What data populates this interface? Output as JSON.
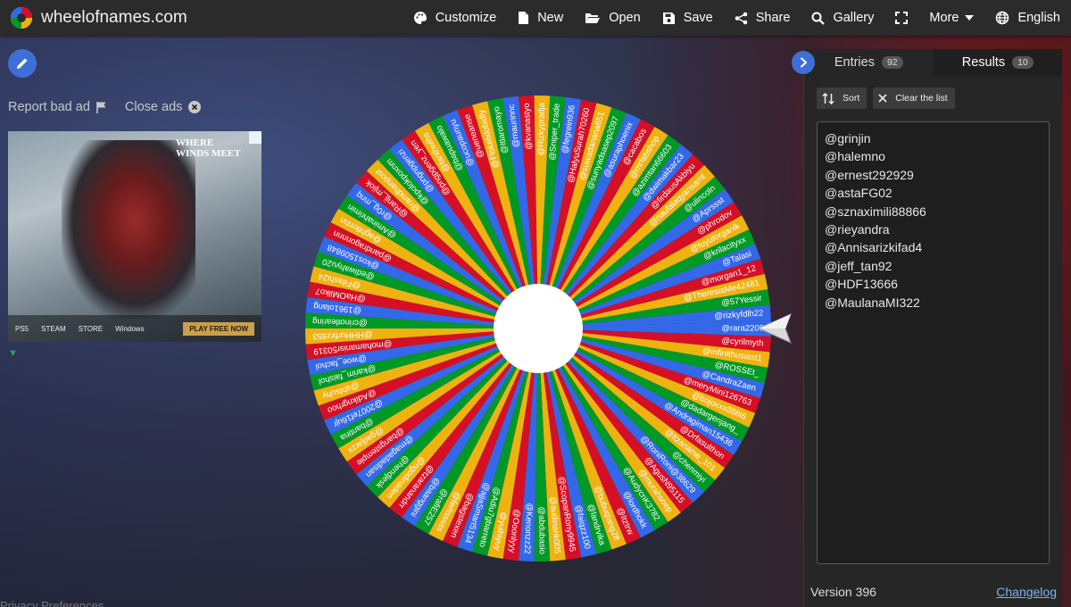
{
  "topbar": {
    "site_name": "wheelofnames.com",
    "nav": [
      {
        "label": "Customize",
        "icon": "palette-icon"
      },
      {
        "label": "New",
        "icon": "new-file-icon"
      },
      {
        "label": "Open",
        "icon": "folder-open-icon"
      },
      {
        "label": "Save",
        "icon": "save-icon"
      },
      {
        "label": "Share",
        "icon": "share-icon"
      },
      {
        "label": "Gallery",
        "icon": "search-icon"
      },
      {
        "label": "",
        "icon": "fullscreen-icon"
      },
      {
        "label": "More",
        "icon": "chevron-down-icon"
      },
      {
        "label": "English",
        "icon": "globe-icon"
      }
    ]
  },
  "left": {
    "report_bad_ad": "Report bad ad",
    "close_ads": "Close ads",
    "ad": {
      "title": "WHERE WINDS MEET",
      "platforms": [
        "PS5",
        "STEAM",
        "STORE",
        "Windows"
      ],
      "cta": "PLAY FREE NOW"
    },
    "privacy": "Privacy Preferences"
  },
  "wheel": {
    "colors": [
      "#3369e8",
      "#d50f25",
      "#eeb211",
      "#009925"
    ],
    "visible_labels": [
      "@rara2208",
      "@cyrilmyth",
      "@infinithusiast1",
      "@ROSSEt_",
      "@CandraZaen",
      "@meryMini126763",
      "@bojoxxx888i6",
      "@dadargenjang_",
      "@Andragiman15436",
      "@Drfasulthon",
      "@Itzaname_101",
      "@chenmiyi",
      "@RoniRoni@38629",
      "@AgusN95115",
      "@murahsoep",
      "@AudycnK3782",
      "@lordhokk",
      "@Itztrw",
      "@bubuqiang28",
      "@landrvika",
      "@faiqzz100",
      "@ScopanRony9945",
      "@audinank005",
      "@abdubasio",
      "@Kenonzz22",
      "@Ooonlyyy",
      "@yuihiyuy",
      "@Adiu7gbarreto",
      "@ajjaSmart5134",
      "@bagstexen",
      "@ferlisssss",
      "@rafiE257",
      "@baanggini",
      "@tzaranandrr",
      "@ngodinaden",
      "@hendjesk",
      "@magadadisan",
      "@bangstemple",
      "@gadjarzx",
      "@bantina",
      "@2007ef16ujr",
      "@Adikngrhoo",
      "@shfsuhy",
      "@karim_faishol",
      "@woe_fachol",
      "@mohamanisr50319",
      "@HHHurfirz853",
      "@crinotlearing",
      "@1961olang",
      "@HaOMilko7",
      "@Fifashi24",
      "@ediwahyu20",
      "@kos1509848",
      "@pandragonnnn",
      "@aghtkmhn",
      "@Aminahrimin",
      "@r0g_mnq",
      "@Ranjj_mjiok",
      "@ramdhanpost",
      "@kpolokpoxnm",
      "@pngnpgenzi",
      "@pngpgenz_yen",
      "@fanthwihs",
      "@bapuawalo",
      "@ucopaunyu",
      "@ueneanse",
      "@Flokelxlobidfy",
      "@ltlaromayo",
      "@maurinnc",
      "@kvanastyo",
      "@Rizkypradja",
      "@Sniper_trade",
      "@fegrein936",
      "@HalyuSurah70260",
      "@suwadanana651",
      "@sunyadsasep2097",
      "@asuraphoenix",
      "@cacabos",
      "@mrfabshop",
      "@azimtan66603",
      "@dwimakbar23",
      "@firdausAkbiyu",
      "@naufalaqyansamt",
      "@ulincoln",
      "@Aprssst",
      "@phrodov",
      "@tuyulorganik",
      "@krilacityxx",
      "@Talasi",
      "@morgan1_12",
      "@TheresiaMe42481",
      "@57Yessir",
      "@rizkyfdlh22"
    ]
  },
  "panel": {
    "tabs": [
      {
        "label": "Entries",
        "count": "92"
      },
      {
        "label": "Results",
        "count": "10"
      }
    ],
    "sort_label": "Sort",
    "clear_label": "Clear the list",
    "results": [
      "@grinjin",
      "@halemno",
      "@ernest292929",
      "@astaFG02",
      "@sznaximili88866",
      "@rieyandra",
      "@Annisarizkifad4",
      "@jeff_tan92",
      "@HDF13666",
      "@MaulanaMI322"
    ],
    "version": "Version 396",
    "changelog": "Changelog"
  }
}
